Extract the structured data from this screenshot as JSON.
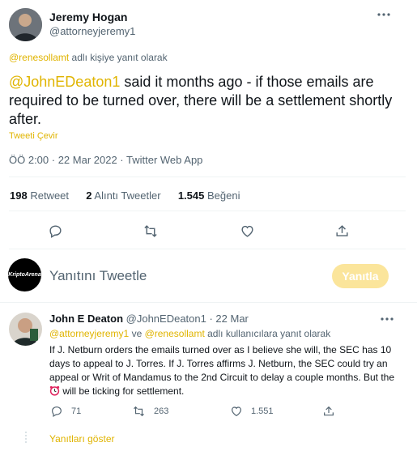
{
  "main_tweet": {
    "author_name": "Jeremy Hogan",
    "author_handle": "@attorneyjeremy1",
    "reply_context_mention": "@renesollamt",
    "reply_context_suffix": " adlı kişiye yanıt olarak",
    "text_mention": "@JohnEDeaton1",
    "text_body": " said it months ago - if those emails are required to be turned over, there will be a settlement shortly after.",
    "translate_label": "Tweeti Çevir",
    "timestamp": "ÖÖ 2:00 · 22 Mar 2022 · Twitter Web App",
    "stats": {
      "retweets_count": "198",
      "retweets_label": "Retweet",
      "quotes_count": "2",
      "quotes_label": "Alıntı Tweetler",
      "likes_count": "1.545",
      "likes_label": "Beğeni"
    }
  },
  "compose": {
    "avatar_text": "KriptoArena",
    "placeholder": "Yanıtını Tweetle",
    "button_label": "Yanıtla"
  },
  "reply_tweet": {
    "author_name": "John E Deaton",
    "author_handle": "@JohnEDeaton1",
    "date": "· 22 Mar",
    "mention_1": "@attorneyjeremy1",
    "mention_joiner": " ve ",
    "mention_2": "@renesollamt",
    "mention_suffix": " adlı kullanıcılara yanıt olarak",
    "text_before_emoji": "If J. Netburn orders the emails turned over as I believe she will, the SEC has 10 days to appeal to J. Torres. If J. Torres affirms J. Netburn, the SEC could try an appeal or Writ of Mandamus to the 2nd Circuit to delay a couple months. But the ",
    "text_after_emoji": " will be ticking for settlement.",
    "replies": "71",
    "retweets": "263",
    "likes": "1.551",
    "show_replies_label": "Yanıtları göster"
  },
  "colors": {
    "accent": "#e0b400",
    "text": "#0f1419",
    "muted": "#536471",
    "divider": "#eff3f4",
    "button_bg": "#fbe59b"
  },
  "icons": [
    "more-icon",
    "reply-icon",
    "retweet-icon",
    "like-icon",
    "share-icon",
    "alarm-clock-emoji"
  ]
}
